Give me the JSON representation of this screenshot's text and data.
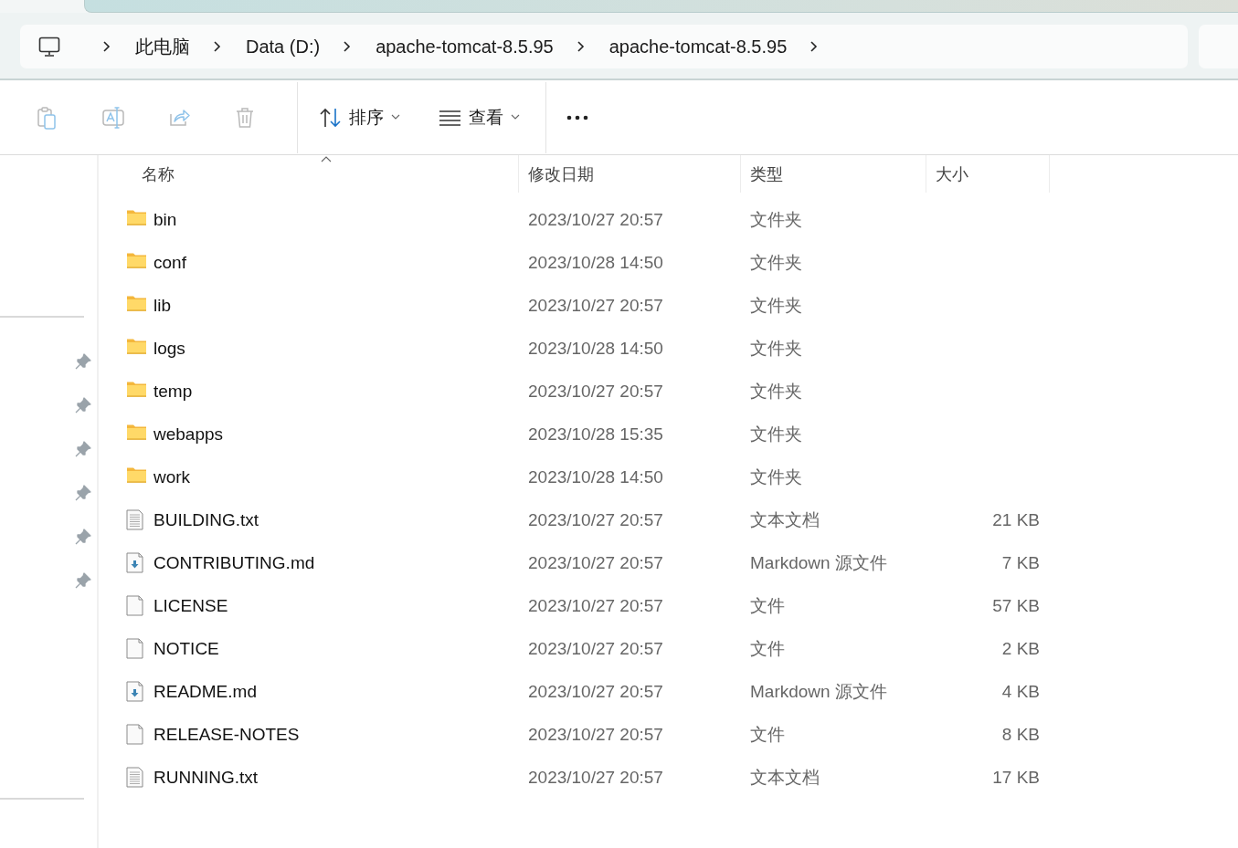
{
  "breadcrumb": [
    "此电脑",
    "Data (D:)",
    "apache-tomcat-8.5.95",
    "apache-tomcat-8.5.95"
  ],
  "toolbar": {
    "actions": [
      {
        "kind": "paste",
        "disabled": true
      },
      {
        "kind": "rename",
        "disabled": true
      },
      {
        "kind": "share",
        "disabled": true
      },
      {
        "kind": "delete",
        "disabled": true
      }
    ],
    "sort": {
      "label": "排序"
    },
    "view": {
      "label": "查看"
    }
  },
  "sidebar": {
    "items": [
      {
        "pinned": true
      },
      {
        "pinned": true
      },
      {
        "pinned": true
      },
      {
        "pinned": true
      },
      {
        "pinned": true
      },
      {
        "pinned": true
      }
    ]
  },
  "table": {
    "columns": [
      {
        "label": "名称",
        "sorted": true
      },
      {
        "label": "修改日期",
        "sorted": false
      },
      {
        "label": "类型",
        "sorted": false
      },
      {
        "label": "大小",
        "sorted": false
      }
    ],
    "rows": [
      {
        "kind": "folder",
        "name": "bin",
        "date": "2023/10/27 20:57",
        "type": "文件夹",
        "size": ""
      },
      {
        "kind": "folder",
        "name": "conf",
        "date": "2023/10/28 14:50",
        "type": "文件夹",
        "size": ""
      },
      {
        "kind": "folder",
        "name": "lib",
        "date": "2023/10/27 20:57",
        "type": "文件夹",
        "size": ""
      },
      {
        "kind": "folder",
        "name": "logs",
        "date": "2023/10/28 14:50",
        "type": "文件夹",
        "size": ""
      },
      {
        "kind": "folder",
        "name": "temp",
        "date": "2023/10/27 20:57",
        "type": "文件夹",
        "size": ""
      },
      {
        "kind": "folder",
        "name": "webapps",
        "date": "2023/10/28 15:35",
        "type": "文件夹",
        "size": ""
      },
      {
        "kind": "folder",
        "name": "work",
        "date": "2023/10/28 14:50",
        "type": "文件夹",
        "size": ""
      },
      {
        "kind": "text",
        "name": "BUILDING.txt",
        "date": "2023/10/27 20:57",
        "type": "文本文档",
        "size": "21 KB"
      },
      {
        "kind": "markdown",
        "name": "CONTRIBUTING.md",
        "date": "2023/10/27 20:57",
        "type": "Markdown 源文件",
        "size": "7 KB"
      },
      {
        "kind": "file",
        "name": "LICENSE",
        "date": "2023/10/27 20:57",
        "type": "文件",
        "size": "57 KB"
      },
      {
        "kind": "file",
        "name": "NOTICE",
        "date": "2023/10/27 20:57",
        "type": "文件",
        "size": "2 KB"
      },
      {
        "kind": "markdown",
        "name": "README.md",
        "date": "2023/10/27 20:57",
        "type": "Markdown 源文件",
        "size": "4 KB"
      },
      {
        "kind": "file",
        "name": "RELEASE-NOTES",
        "date": "2023/10/27 20:57",
        "type": "文件",
        "size": "8 KB"
      },
      {
        "kind": "text",
        "name": "RUNNING.txt",
        "date": "2023/10/27 20:57",
        "type": "文本文档",
        "size": "17 KB"
      }
    ]
  }
}
